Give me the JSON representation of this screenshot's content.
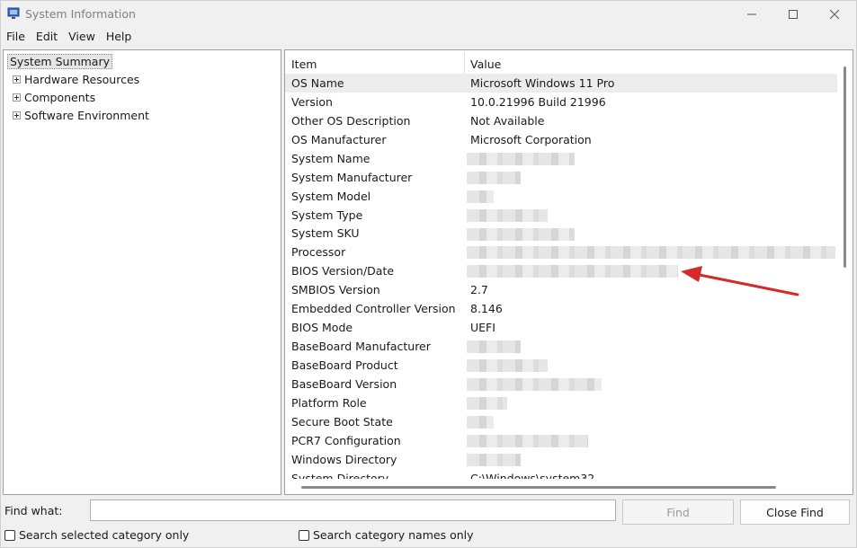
{
  "window": {
    "title": "System Information"
  },
  "menu": [
    "File",
    "Edit",
    "View",
    "Help"
  ],
  "tree": {
    "root": "System Summary",
    "children": [
      "Hardware Resources",
      "Components",
      "Software Environment"
    ]
  },
  "list": {
    "headers": {
      "item": "Item",
      "value": "Value"
    },
    "rows": [
      {
        "item": "OS Name",
        "value": "Microsoft Windows 11 Pro"
      },
      {
        "item": "Version",
        "value": "10.0.21996 Build 21996"
      },
      {
        "item": "Other OS Description",
        "value": "Not Available"
      },
      {
        "item": "OS Manufacturer",
        "value": "Microsoft Corporation"
      },
      {
        "item": "System Name",
        "value": ""
      },
      {
        "item": "System Manufacturer",
        "value": ""
      },
      {
        "item": "System Model",
        "value": ""
      },
      {
        "item": "System Type",
        "value": ""
      },
      {
        "item": "System SKU",
        "value": ""
      },
      {
        "item": "Processor",
        "value": ""
      },
      {
        "item": "BIOS Version/Date",
        "value": ""
      },
      {
        "item": "SMBIOS Version",
        "value": "2.7"
      },
      {
        "item": "Embedded Controller Version",
        "value": "8.146"
      },
      {
        "item": "BIOS Mode",
        "value": "UEFI"
      },
      {
        "item": "BaseBoard Manufacturer",
        "value": ""
      },
      {
        "item": "BaseBoard Product",
        "value": ""
      },
      {
        "item": "BaseBoard Version",
        "value": ""
      },
      {
        "item": "Platform Role",
        "value": ""
      },
      {
        "item": "Secure Boot State",
        "value": ""
      },
      {
        "item": "PCR7 Configuration",
        "value": ""
      },
      {
        "item": "Windows Directory",
        "value": ""
      },
      {
        "item": "System Directory",
        "value": "C:\\Windows\\system32"
      }
    ]
  },
  "find": {
    "label": "Find what:",
    "input_value": "",
    "find_button": "Find",
    "close_button": "Close Find",
    "check_selected": "Search selected category only",
    "check_names": "Search category names only"
  },
  "annotation": {
    "arrow_color": "#d42a2a"
  }
}
